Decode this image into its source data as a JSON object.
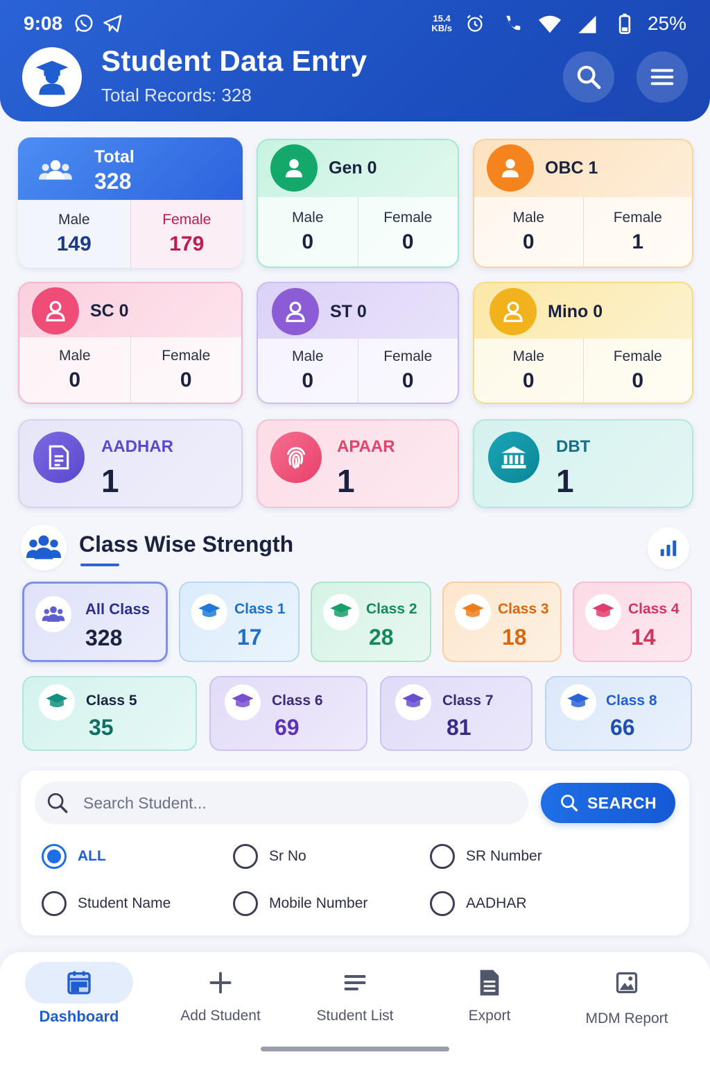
{
  "status": {
    "time": "9:08",
    "speed_top": "15.4",
    "speed_bottom": "KB/s",
    "battery": "25%"
  },
  "header": {
    "title": "Student Data Entry",
    "subtitle": "Total Records: 328"
  },
  "summary": {
    "total": {
      "label": "Total",
      "value": "328",
      "male_label": "Male",
      "male": "149",
      "female_label": "Female",
      "female": "179"
    },
    "gen": {
      "label": "Gen 0",
      "male_label": "Male",
      "male": "0",
      "female_label": "Female",
      "female": "0"
    },
    "obc": {
      "label": "OBC 1",
      "male_label": "Male",
      "male": "0",
      "female_label": "Female",
      "female": "1"
    },
    "sc": {
      "label": "SC 0",
      "male_label": "Male",
      "male": "0",
      "female_label": "Female",
      "female": "0"
    },
    "st": {
      "label": "ST 0",
      "male_label": "Male",
      "male": "0",
      "female_label": "Female",
      "female": "0"
    },
    "mino": {
      "label": "Mino 0",
      "male_label": "Male",
      "male": "0",
      "female_label": "Female",
      "female": "0"
    }
  },
  "documents": {
    "aadhar": {
      "label": "AADHAR",
      "value": "1"
    },
    "apaar": {
      "label": "APAAR",
      "value": "1"
    },
    "dbt": {
      "label": "DBT",
      "value": "1"
    }
  },
  "class_section": {
    "title": "Class Wise Strength",
    "tiles": [
      {
        "label": "All Class",
        "value": "328"
      },
      {
        "label": "Class 1",
        "value": "17"
      },
      {
        "label": "Class 2",
        "value": "28"
      },
      {
        "label": "Class 3",
        "value": "18"
      },
      {
        "label": "Class 4",
        "value": "14"
      },
      {
        "label": "Class 5",
        "value": "35"
      },
      {
        "label": "Class 6",
        "value": "69"
      },
      {
        "label": "Class 7",
        "value": "81"
      },
      {
        "label": "Class 8",
        "value": "66"
      }
    ]
  },
  "search": {
    "placeholder": "Search Student...",
    "button_label": "SEARCH",
    "options": [
      "ALL",
      "Sr No",
      "SR Number",
      "Student Name",
      "Mobile Number",
      "AADHAR"
    ],
    "selected": "ALL"
  },
  "nav": {
    "items": [
      {
        "label": "Dashboard",
        "icon": "dashboard-icon"
      },
      {
        "label": "Add Student",
        "icon": "plus-icon"
      },
      {
        "label": "Student List",
        "icon": "list-icon"
      },
      {
        "label": "Export",
        "icon": "document-icon"
      },
      {
        "label": "MDM Report",
        "icon": "image-icon"
      }
    ],
    "active": "Dashboard"
  },
  "colors": {
    "primary": "#1e5ed0",
    "header": "#1d4fc0"
  }
}
